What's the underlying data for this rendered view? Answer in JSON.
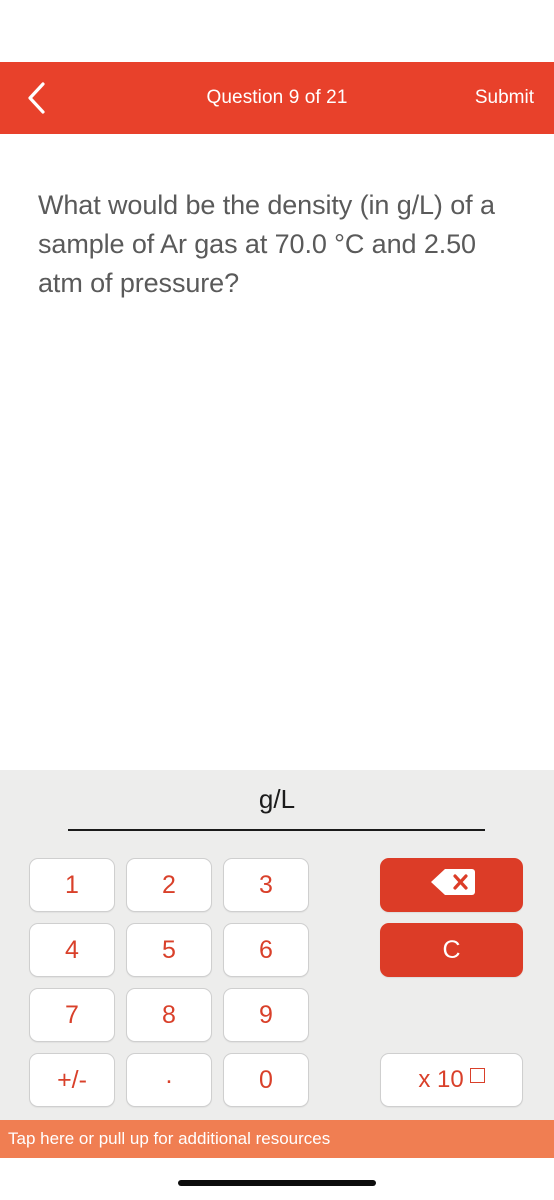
{
  "header": {
    "title": "Question 9 of 21",
    "submit_label": "Submit",
    "back_icon": "chevron-left-icon",
    "background_color": "#E8412B",
    "text_color": "#FFFFFF"
  },
  "question": {
    "text": "What would be the density (in g/L) of a sample of Ar gas at 70.0 °C and 2.50 atm of pressure?"
  },
  "answer": {
    "value": "",
    "unit": "g/L"
  },
  "keypad": {
    "keys": [
      {
        "label": "1",
        "name": "key-1"
      },
      {
        "label": "2",
        "name": "key-2"
      },
      {
        "label": "3",
        "name": "key-3"
      },
      {
        "label": "4",
        "name": "key-4"
      },
      {
        "label": "5",
        "name": "key-5"
      },
      {
        "label": "6",
        "name": "key-6"
      },
      {
        "label": "7",
        "name": "key-7"
      },
      {
        "label": "8",
        "name": "key-8"
      },
      {
        "label": "9",
        "name": "key-9"
      },
      {
        "label": "+/-",
        "name": "key-sign"
      },
      {
        "label": ".",
        "name": "key-decimal"
      },
      {
        "label": "0",
        "name": "key-0"
      }
    ],
    "backspace_icon": "backspace-delete-icon",
    "clear_label": "C",
    "exponent_label": "x 10",
    "key_text_color": "#D9402A",
    "action_color": "#DC3C27",
    "panel_color": "#EDEDEC"
  },
  "resources": {
    "label": "Tap here or pull up for additional resources",
    "background_color": "#F07E52"
  }
}
